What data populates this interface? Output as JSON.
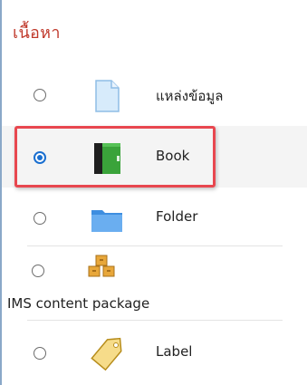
{
  "section": {
    "title": "เนื้อหา"
  },
  "resources": [
    {
      "label": "แหล่งข้อมูล",
      "icon": "file-icon",
      "selected": false
    },
    {
      "label": "Book",
      "icon": "book-icon",
      "selected": true
    },
    {
      "label": "Folder",
      "icon": "folder-icon",
      "selected": false
    },
    {
      "label": "IMS content package",
      "icon": "package-icon",
      "selected": false
    },
    {
      "label": "Label",
      "icon": "label-tag-icon",
      "selected": false
    }
  ],
  "colors": {
    "title": "#c0392b",
    "highlight": "#e8474f",
    "radio_selected": "#1a6fd0"
  }
}
